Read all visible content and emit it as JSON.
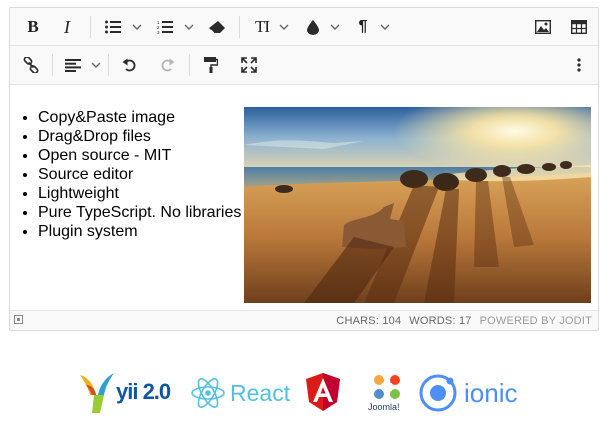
{
  "toolbar": {
    "row1": [
      {
        "name": "bold-button",
        "icon": "bold-icon",
        "glyph": "B"
      },
      {
        "name": "italic-button",
        "icon": "italic-icon",
        "glyph": "I"
      },
      {
        "name": "unordered-list-button",
        "icon": "bullet-list-icon",
        "has_dropdown": true
      },
      {
        "name": "ordered-list-button",
        "icon": "numbered-list-icon",
        "has_dropdown": true
      },
      {
        "name": "eraser-button",
        "icon": "eraser-icon"
      },
      {
        "name": "font-size-button",
        "icon": "text-size-icon",
        "glyph": "TI",
        "has_dropdown": true
      },
      {
        "name": "brush-button",
        "icon": "droplet-icon",
        "has_dropdown": true
      },
      {
        "name": "paragraph-button",
        "icon": "pilcrow-icon",
        "glyph": "¶",
        "has_dropdown": true
      },
      {
        "name": "image-button",
        "icon": "image-icon"
      },
      {
        "name": "table-button",
        "icon": "table-icon"
      }
    ],
    "row2": [
      {
        "name": "link-button",
        "icon": "link-icon"
      },
      {
        "name": "align-button",
        "icon": "align-left-icon",
        "has_dropdown": true
      },
      {
        "name": "undo-button",
        "icon": "undo-icon"
      },
      {
        "name": "redo-button",
        "icon": "redo-icon",
        "disabled": true
      },
      {
        "name": "copy-format-button",
        "icon": "paint-roller-icon"
      },
      {
        "name": "fullsize-button",
        "icon": "expand-icon"
      },
      {
        "name": "more-button",
        "icon": "dots-vertical-icon"
      }
    ]
  },
  "content": {
    "features": [
      "Copy&Paste image",
      "Drag&Drop files",
      "Open source - MIT",
      "Source editor",
      "Lightweight",
      "Pure TypeScript. No libraries",
      "Plugin system"
    ],
    "image": {
      "subject": "sunset beach with boulders and driftwood"
    }
  },
  "status": {
    "chars": "CHARS: 104",
    "words": "WORDS: 17",
    "powered": "POWERED BY JODIT"
  },
  "logos": {
    "yii": {
      "text": "yii 2.0",
      "color": "#0f57a3"
    },
    "react": {
      "text": "React",
      "color": "#53c1de"
    },
    "angular": {
      "color": "#dd1b16"
    },
    "joomla": {
      "text": "Joomla!"
    },
    "ionic": {
      "text": "ionic",
      "color": "#4e8ef7"
    }
  },
  "colors": {
    "toolbar_bg": "#f9f9f9",
    "border": "#dadada",
    "icon": "#2b2b2b",
    "icon_disabled": "#b5b5b5"
  }
}
